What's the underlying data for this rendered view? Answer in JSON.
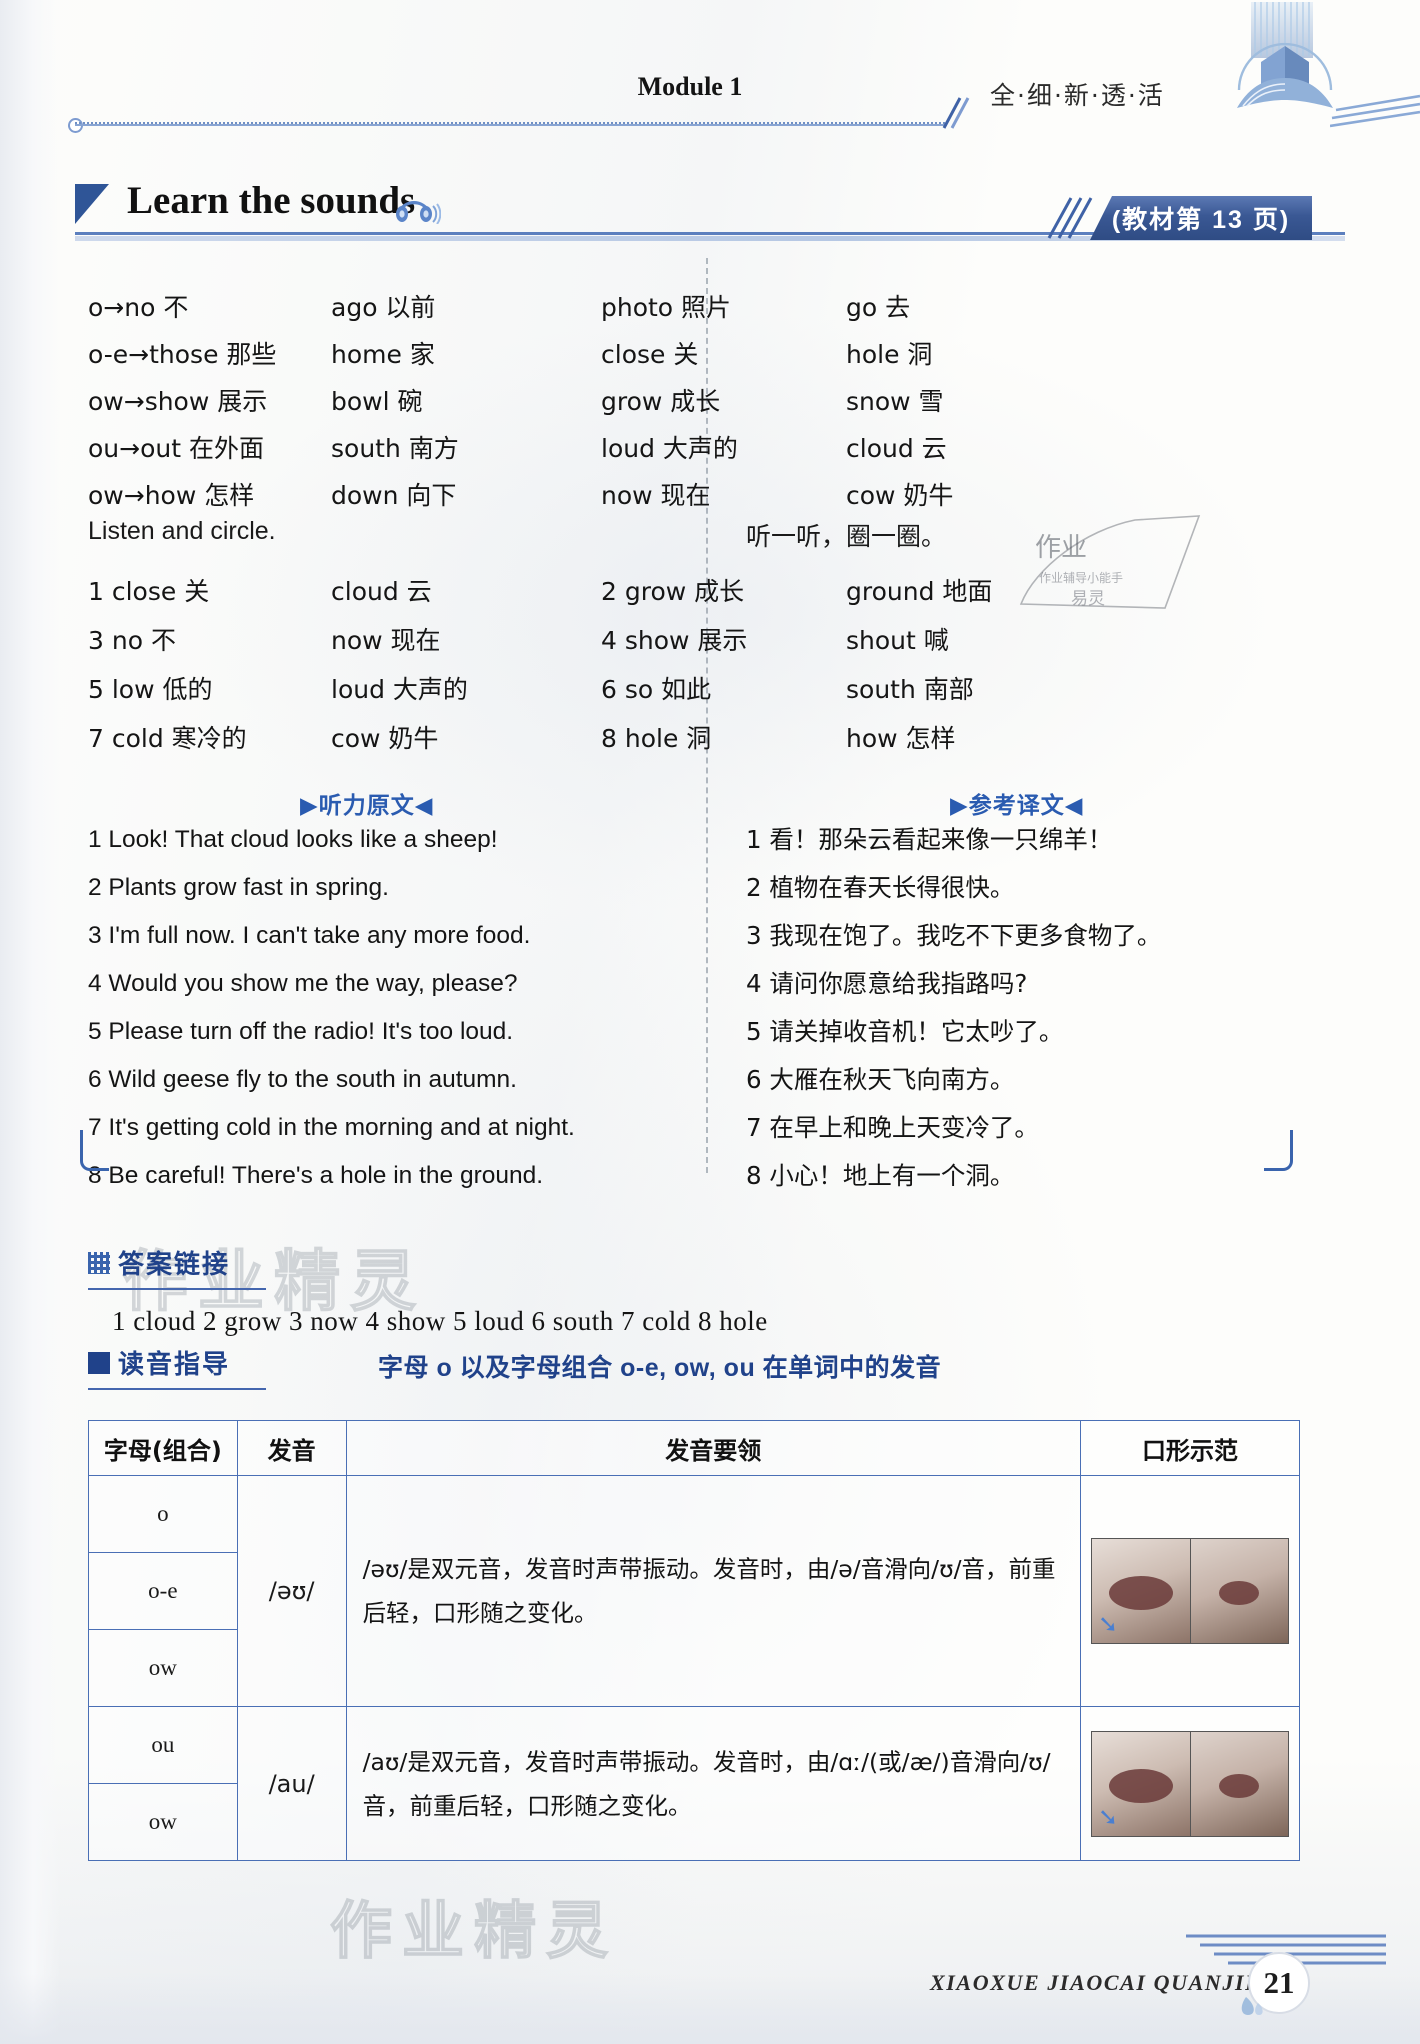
{
  "header": {
    "module": "Module 1",
    "slogan": "全·细·新·透·活",
    "logo_icon": "open-book-logo"
  },
  "section": {
    "title": "Learn the sounds",
    "headphone_icon": "headphones-icon",
    "badge": "(教材第 13 页)"
  },
  "word_list": [
    {
      "left": "o→no 不",
      "col2": "ago 以前",
      "col3": "photo 照片",
      "col4": "go 去"
    },
    {
      "left": "o-e→those 那些",
      "col2": "home 家",
      "col3": "close 关",
      "col4": "hole 洞"
    },
    {
      "left": "ow→show 展示",
      "col2": "bowl 碗",
      "col3": "grow 成长",
      "col4": "snow 雪"
    },
    {
      "left": "ou→out 在外面",
      "col2": "south 南方",
      "col3": "loud 大声的",
      "col4": "cloud 云"
    },
    {
      "left": "ow→how 怎样",
      "col2": "down 向下",
      "col3": "now 现在",
      "col4": "cow 奶牛"
    }
  ],
  "exercise": {
    "instruction_en": "Listen and circle.",
    "instruction_zh": "听一听，圈一圈。",
    "rows": [
      {
        "a": "1 close 关",
        "b": "cloud 云",
        "c": "2 grow 成长",
        "d": "ground 地面"
      },
      {
        "a": "3 no 不",
        "b": "now 现在",
        "c": "4 show 展示",
        "d": "shout 喊"
      },
      {
        "a": "5 low 低的",
        "b": "loud 大声的",
        "c": "6 so 如此",
        "d": "south 南部"
      },
      {
        "a": "7 cold 寒冷的",
        "b": "cow 奶牛",
        "c": "8 hole 洞",
        "d": "how 怎样"
      }
    ]
  },
  "script": {
    "tag": "▶听力原文◀",
    "lines": [
      "1 Look! That cloud looks like a sheep!",
      "2 Plants grow fast in spring.",
      "3 I'm full now. I can't take any more food.",
      "4 Would you show me the way, please?",
      "5 Please turn off the radio! It's too loud.",
      "6 Wild geese fly to the south in autumn.",
      "7 It's getting cold in the morning and at night.",
      "8 Be careful! There's a hole in the ground."
    ]
  },
  "translation": {
    "tag": "▶参考译文◀",
    "lines": [
      "1 看！那朵云看起来像一只绵羊！",
      "2 植物在春天长得很快。",
      "3 我现在饱了。我吃不下更多食物了。",
      "4 请问你愿意给我指路吗?",
      "5 请关掉收音机！它太吵了。",
      "6 大雁在秋天飞向南方。",
      "7 在早上和晚上天变冷了。",
      "8 小心！地上有一个洞。"
    ]
  },
  "answers": {
    "label": "答案链接",
    "line": "1 cloud   2 grow   3 now   4 show   5 loud   6 south   7 cold   8 hole"
  },
  "guide": {
    "label": "读音指导",
    "subtitle": "字母 o 以及字母组合 o-e, ow, ou 在单词中的发音"
  },
  "table": {
    "headers": [
      "字母(组合)",
      "发音",
      "发音要领",
      "口形示范"
    ],
    "group1": {
      "letters": [
        "o",
        "o-e",
        "ow"
      ],
      "phoneme": "/əʊ/",
      "description": "/əʊ/是双元音，发音时声带振动。发音时，由/ə/音滑向/ʊ/音，前重后轻，口形随之变化。"
    },
    "group2": {
      "letters": [
        "ou",
        "ow"
      ],
      "phoneme": "/au/",
      "description": "/aʊ/是双元音，发音时声带振动。发音时，由/ɑː/(或/æ/)音滑向/ʊ/音，前重后轻，口形随之变化。"
    }
  },
  "footer": {
    "series": "XIAOXUE JIAOCAI QUANJIE",
    "page": "21"
  },
  "watermarks": {
    "w1": "作业精灵",
    "w2": "作业精灵",
    "stamp": "作业"
  }
}
